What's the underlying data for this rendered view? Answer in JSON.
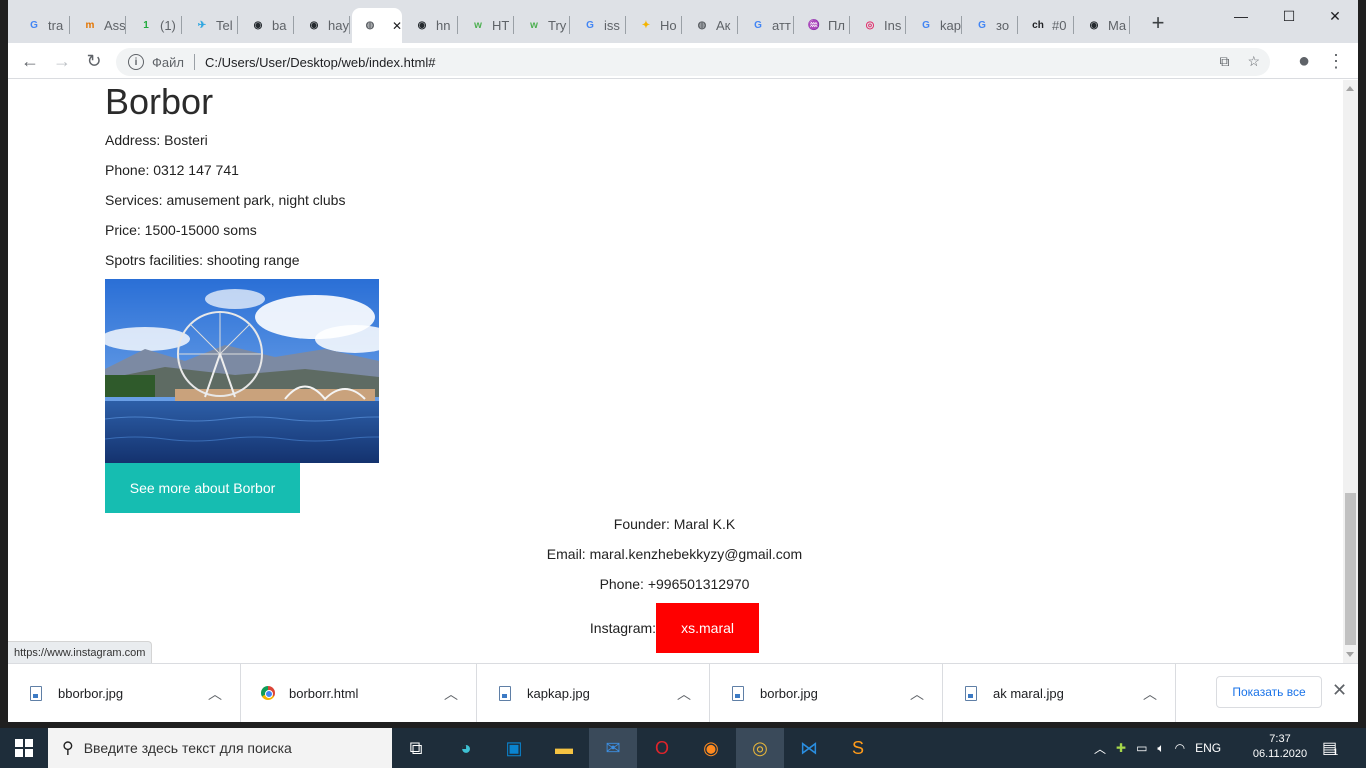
{
  "browser": {
    "tabs": [
      {
        "label": "tra",
        "fav": "G",
        "color": "#4285f4"
      },
      {
        "label": "Ass",
        "fav": "m",
        "color": "#e37400"
      },
      {
        "label": "(1)",
        "fav": "1",
        "color": "#1faa3c"
      },
      {
        "label": "Tel",
        "fav": "✈",
        "color": "#2ca5e0"
      },
      {
        "label": "ba",
        "fav": "◉",
        "color": "#24292e"
      },
      {
        "label": "hay",
        "fav": "◉",
        "color": "#24292e"
      },
      {
        "label": "",
        "fav": "◍",
        "color": "#5f6368"
      },
      {
        "label": "hn",
        "fav": "◉",
        "color": "#24292e"
      },
      {
        "label": "HT",
        "fav": "w",
        "color": "#4caf50"
      },
      {
        "label": "Try",
        "fav": "w",
        "color": "#4caf50"
      },
      {
        "label": "iss",
        "fav": "G",
        "color": "#4285f4"
      },
      {
        "label": "Ho",
        "fav": "✦",
        "color": "#f4b400"
      },
      {
        "label": "Ак",
        "fav": "◍",
        "color": "#5f6368"
      },
      {
        "label": "атт",
        "fav": "G",
        "color": "#4285f4"
      },
      {
        "label": "Пл",
        "fav": "♒",
        "color": "#1565c0"
      },
      {
        "label": "Ins",
        "fav": "◎",
        "color": "#e1306c"
      },
      {
        "label": "kap",
        "fav": "G",
        "color": "#4285f4"
      },
      {
        "label": "зо",
        "fav": "G",
        "color": "#4285f4"
      },
      {
        "label": "#0",
        "fav": "ch",
        "color": "#202124"
      },
      {
        "label": "Ma",
        "fav": "◉",
        "color": "#24292e"
      }
    ],
    "newtab_icon": "+",
    "window_controls": {
      "minimize": "—",
      "maximize": "☐",
      "close": "✕"
    },
    "tab_close": "✕",
    "address": {
      "label": "Файл",
      "url": "C:/Users/User/Desktop/web/index.html#"
    },
    "status_url": "https://www.instagram.com"
  },
  "page": {
    "title": "Borbor",
    "info": [
      "Address: Bosteri",
      "Phone: 0312 147 741",
      "Services: amusement park, night clubs",
      "Price: 1500-15000 soms",
      "Spotrs facilities: shooting range"
    ],
    "see_more": "See more about Borbor",
    "footer": {
      "founder": "Founder: Maral K.K",
      "email": "Email: maral.kenzhebekkyzy@gmail.com",
      "phone": "Phone: +996501312970",
      "instagram_label": "Instagram:",
      "instagram_handle": "xs.maral"
    }
  },
  "downloads": {
    "items": [
      "bborbor.jpg",
      "borborr.html",
      "kapkap.jpg",
      "borbor.jpg",
      "ak maral.jpg"
    ],
    "show_all": "Показать все",
    "close": "✕"
  },
  "taskbar": {
    "search_placeholder": "Введите здесь текст для поиска",
    "lang": "ENG",
    "time": "7:37",
    "date": "06.11.2020",
    "notifications": "1"
  },
  "colors": {
    "see_more_bg": "#16bdb1",
    "instagram_bg": "#ff0000"
  }
}
